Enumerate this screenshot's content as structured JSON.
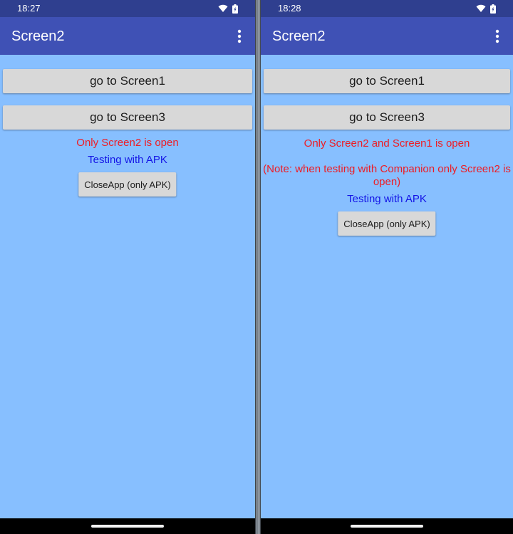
{
  "colors": {
    "status_bar": "#2f3f8f",
    "app_bar": "#3f51b5",
    "screen_background": "#87bfff",
    "button_background": "#d8d8d8",
    "red_text": "#ee1c24",
    "blue_text": "#1414e6"
  },
  "left": {
    "status": {
      "time": "18:27",
      "icons": [
        "wifi-icon",
        "battery-icon"
      ]
    },
    "app_bar": {
      "title": "Screen2",
      "menu_icon": "more-vert-icon"
    },
    "buttons": {
      "screen1": "go to Screen1",
      "screen3": "go to Screen3"
    },
    "message": "Only Screen2 is open",
    "testing": "Testing with APK",
    "close_button": "CloseApp (only APK)"
  },
  "right": {
    "status": {
      "time": "18:28",
      "icons": [
        "wifi-icon",
        "battery-icon"
      ]
    },
    "app_bar": {
      "title": "Screen2",
      "menu_icon": "more-vert-icon"
    },
    "buttons": {
      "screen1": "go to Screen1",
      "screen3": "go to Screen3"
    },
    "message": "Only Screen2 and Screen1 is open",
    "note": "(Note: when testing with Companion only Screen2 is open)",
    "testing": "Testing with APK",
    "close_button": "CloseApp (only APK)"
  }
}
